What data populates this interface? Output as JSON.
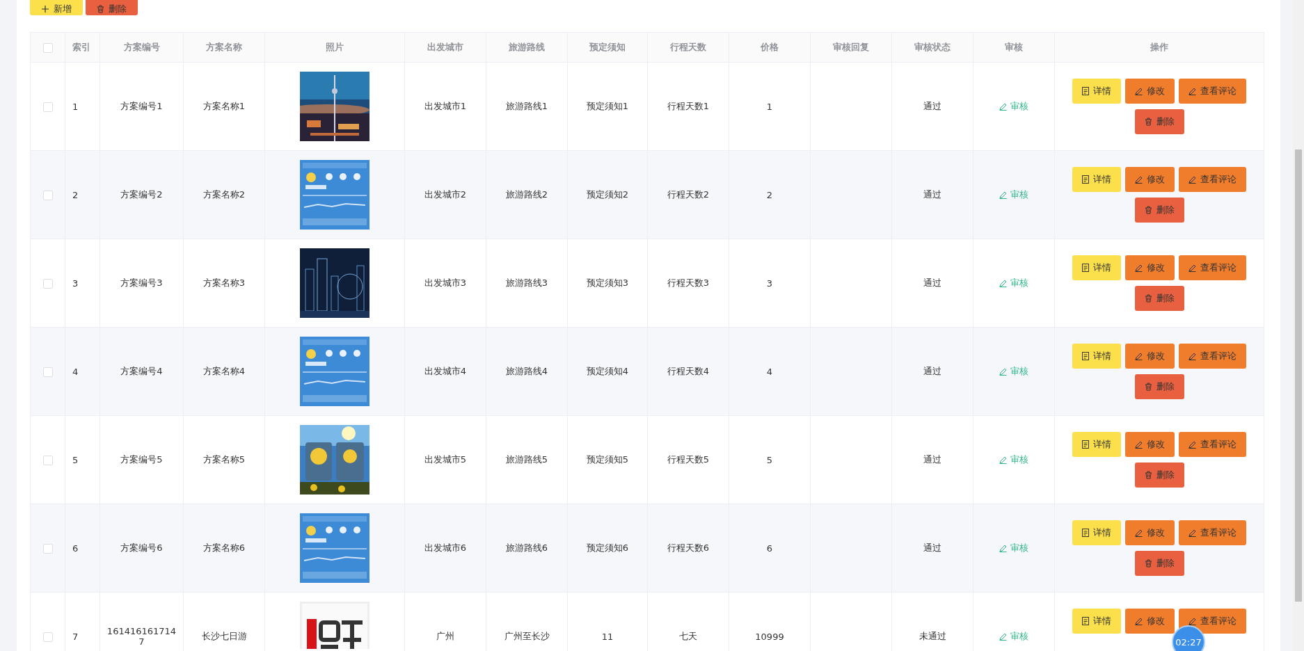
{
  "toolbar": {
    "buttons": [
      {
        "kind": "add",
        "label": "新增"
      },
      {
        "kind": "delete",
        "label": "删除"
      }
    ]
  },
  "table": {
    "select_all": {
      "checked": false
    },
    "columns": [
      "索引",
      "方案编号",
      "方案名称",
      "照片",
      "出发城市",
      "旅游路线",
      "预定须知",
      "行程天数",
      "价格",
      "审核回复",
      "审核状态",
      "审核",
      "操作"
    ],
    "rows": [
      {
        "checked": false,
        "index": "1",
        "code": "方案编号1",
        "name": "方案名称1",
        "photo": {
          "kind": "picture"
        },
        "city": "出发城市1",
        "route": "旅游路线1",
        "notice": "预定须知1",
        "days": "行程天数1",
        "price": "1",
        "status": "通过",
        "audit": "审核",
        "actions": [
          {
            "kind": "detail",
            "label": "详情"
          },
          {
            "kind": "edit",
            "label": "修改"
          },
          {
            "kind": "edit",
            "label": "查看评论"
          },
          {
            "kind": "delete",
            "label": "删除"
          }
        ]
      },
      {
        "checked": false,
        "index": "2",
        "code": "方案编号2",
        "name": "方案名称2",
        "photo": {
          "kind": "picture"
        },
        "city": "出发城市2",
        "route": "旅游路线2",
        "notice": "预定须知2",
        "days": "行程天数2",
        "price": "2",
        "status": "通过",
        "audit": "审核",
        "actions": [
          {
            "kind": "detail",
            "label": "详情"
          },
          {
            "kind": "edit",
            "label": "修改"
          },
          {
            "kind": "edit",
            "label": "查看评论"
          },
          {
            "kind": "delete",
            "label": "删除"
          }
        ]
      },
      {
        "checked": false,
        "index": "3",
        "code": "方案编号3",
        "name": "方案名称3",
        "photo": {
          "kind": "picture"
        },
        "city": "出发城市3",
        "route": "旅游路线3",
        "notice": "预定须知3",
        "days": "行程天数3",
        "price": "3",
        "status": "通过",
        "audit": "审核",
        "actions": [
          {
            "kind": "detail",
            "label": "详情"
          },
          {
            "kind": "edit",
            "label": "修改"
          },
          {
            "kind": "edit",
            "label": "查看评论"
          },
          {
            "kind": "delete",
            "label": "删除"
          }
        ]
      },
      {
        "checked": false,
        "index": "4",
        "code": "方案编号4",
        "name": "方案名称4",
        "photo": {
          "kind": "picture"
        },
        "city": "出发城市4",
        "route": "旅游路线4",
        "notice": "预定须知4",
        "days": "行程天数4",
        "price": "4",
        "status": "通过",
        "audit": "审核",
        "actions": [
          {
            "kind": "detail",
            "label": "详情"
          },
          {
            "kind": "edit",
            "label": "修改"
          },
          {
            "kind": "edit",
            "label": "查看评论"
          },
          {
            "kind": "delete",
            "label": "删除"
          }
        ]
      },
      {
        "checked": false,
        "index": "5",
        "code": "方案编号5",
        "name": "方案名称5",
        "photo": {
          "kind": "picture"
        },
        "city": "出发城市5",
        "route": "旅游路线5",
        "notice": "预定须知5",
        "days": "行程天数5",
        "price": "5",
        "status": "通过",
        "audit": "审核",
        "actions": [
          {
            "kind": "detail",
            "label": "详情"
          },
          {
            "kind": "edit",
            "label": "修改"
          },
          {
            "kind": "edit",
            "label": "查看评论"
          },
          {
            "kind": "delete",
            "label": "删除"
          }
        ]
      },
      {
        "checked": false,
        "index": "6",
        "code": "方案编号6",
        "name": "方案名称6",
        "photo": {
          "kind": "picture"
        },
        "city": "出发城市6",
        "route": "旅游路线6",
        "notice": "预定须知6",
        "days": "行程天数6",
        "price": "6",
        "status": "通过",
        "audit": "审核",
        "actions": [
          {
            "kind": "detail",
            "label": "详情"
          },
          {
            "kind": "edit",
            "label": "修改"
          },
          {
            "kind": "edit",
            "label": "查看评论"
          },
          {
            "kind": "delete",
            "label": "删除"
          }
        ]
      },
      {
        "checked": false,
        "index": "7",
        "code": "1614161617147",
        "name": "长沙七日游",
        "photo": {
          "kind": "picture"
        },
        "city": "广州",
        "route": "广州至长沙",
        "notice": "11",
        "days": "七天",
        "price": "10999",
        "status": "未通过",
        "audit": "审核",
        "actions": [
          {
            "kind": "detail",
            "label": "详情"
          },
          {
            "kind": "edit",
            "label": "修改"
          },
          {
            "kind": "edit",
            "label": "查看评论"
          }
        ]
      }
    ]
  },
  "timer": "02:27"
}
